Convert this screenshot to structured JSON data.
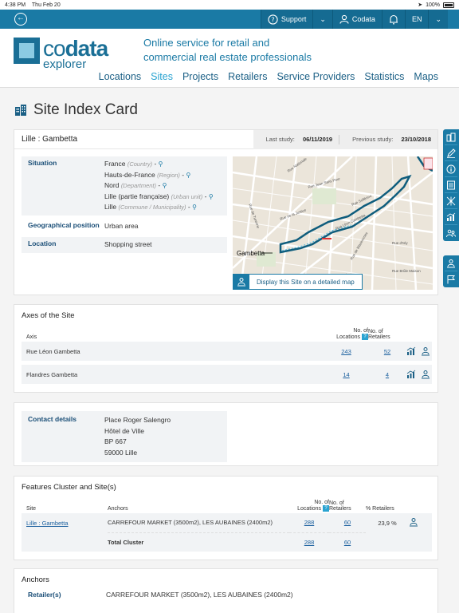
{
  "status_bar": {
    "time": "4:38 PM",
    "date": "Thu Feb 20",
    "battery": "100%"
  },
  "topbar": {
    "support_label": "Support",
    "user_label": "Codata",
    "language": "EN"
  },
  "header": {
    "logo_co": "co",
    "logo_data": "data",
    "logo_sub": "explorer",
    "tagline_1": "Online service for retail and",
    "tagline_2": "commercial real estate professionals"
  },
  "nav": [
    "Locations",
    "Sites",
    "Projects",
    "Retailers",
    "Service Providers",
    "Statistics",
    "Maps"
  ],
  "nav_active": "Sites",
  "page_title": "Site Index Card",
  "site": {
    "name": "Lille : Gambetta",
    "last_study_label": "Last study:",
    "last_study": "06/11/2019",
    "previous_study_label": "Previous study:",
    "previous_study": "23/10/2018",
    "situation_label": "Situation",
    "situation": [
      {
        "name": "France",
        "type": "(Country)"
      },
      {
        "name": "Hauts-de-France",
        "type": "(Region)"
      },
      {
        "name": "Nord",
        "type": "(Department)"
      },
      {
        "name": "Lille (partie française)",
        "type": "(Urban unit)"
      },
      {
        "name": "Lille",
        "type": "(Commune / Municipality)"
      }
    ],
    "geo_label": "Geographical position",
    "geo_value": "Urban area",
    "location_label": "Location",
    "location_value": "Shopping street",
    "map_label_gambetta": "Gambetta",
    "map_button": "Display this Site on a detailed map"
  },
  "axes": {
    "title": "Axes of the Site",
    "col_axis": "Axis",
    "col_locations_1": "No. of",
    "col_locations_2": "Locations",
    "col_retailers_1": "No. of",
    "col_retailers_2": "Retailers",
    "rows": [
      {
        "name": "Rue Léon Gambetta",
        "locations": "243",
        "retailers": "52"
      },
      {
        "name": "Flandres Gambetta",
        "locations": "14",
        "retailers": "4"
      }
    ]
  },
  "contact": {
    "label": "Contact details",
    "lines": [
      "Place Roger Salengro",
      "Hôtel de Ville",
      "BP 667",
      "59000 Lille"
    ]
  },
  "features": {
    "title": "Features Cluster and Site(s)",
    "col_site": "Site",
    "col_anchors": "Anchors",
    "col_locations_1": "No. of",
    "col_locations_2": "Locations",
    "col_retailers_1": "No. of",
    "col_retailers_2": "Retailers",
    "col_pct": "% Retailers",
    "row": {
      "site": "Lille : Gambetta",
      "anchors": "CARREFOUR MARKET (3500m2), LES AUBAINES (2400m2)",
      "locations": "288",
      "retailers": "60",
      "pct": "23,9 %"
    },
    "total": {
      "label": "Total Cluster",
      "locations": "288",
      "retailers": "60"
    }
  },
  "anchors": {
    "title": "Anchors",
    "retailer_label": "Retailer(s)",
    "retailer_value": "CARREFOUR MARKET (3500m2), LES AUBAINES (2400m2)"
  },
  "map_streets": [
    "Rue Nationale",
    "Rue Solférino",
    "Rue d'Isly",
    "Rue de Turenne",
    "Rue de Wazemmes",
    "Rue Jean Sans Peur",
    "Rue de la Justice",
    "Rue Léon Gambetta",
    "Rue Brûle Maison",
    "Rue Littré"
  ],
  "colors": {
    "brand": "#1a7aa5",
    "accent": "#2aa3d1",
    "nav": "#1a5f85"
  }
}
